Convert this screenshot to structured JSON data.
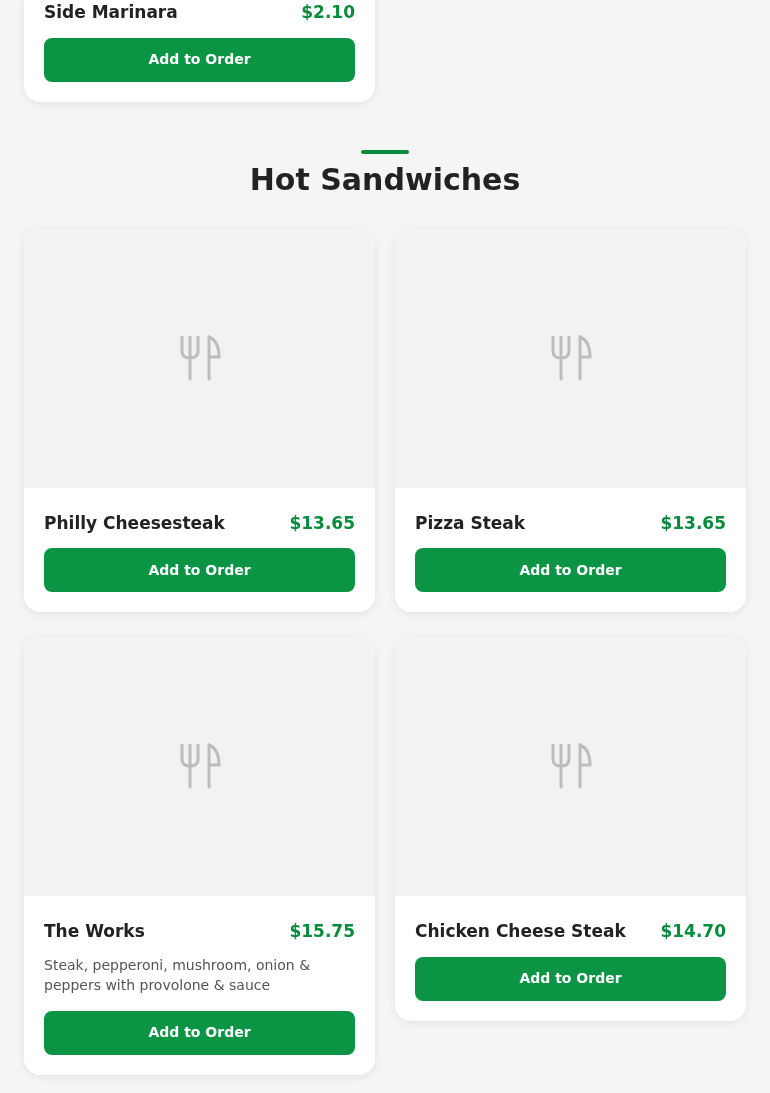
{
  "sections": [
    {
      "items": [
        {
          "name": "Side Marinara",
          "price": "$2.10",
          "button": "Add to Order",
          "has_image": false
        }
      ]
    },
    {
      "title": "Hot Sandwiches",
      "items": [
        {
          "name": "Philly Cheesesteak",
          "price": "$13.65",
          "button": "Add to Order",
          "has_image": true
        },
        {
          "name": "Pizza Steak",
          "price": "$13.65",
          "button": "Add to Order",
          "has_image": true
        },
        {
          "name": "The Works",
          "price": "$15.75",
          "description": "Steak, pepperoni, mushroom, onion & peppers with provolone & sauce",
          "button": "Add to Order",
          "has_image": true
        },
        {
          "name": "Chicken Cheese Steak",
          "price": "$14.70",
          "button": "Add to Order",
          "has_image": true
        }
      ]
    }
  ]
}
